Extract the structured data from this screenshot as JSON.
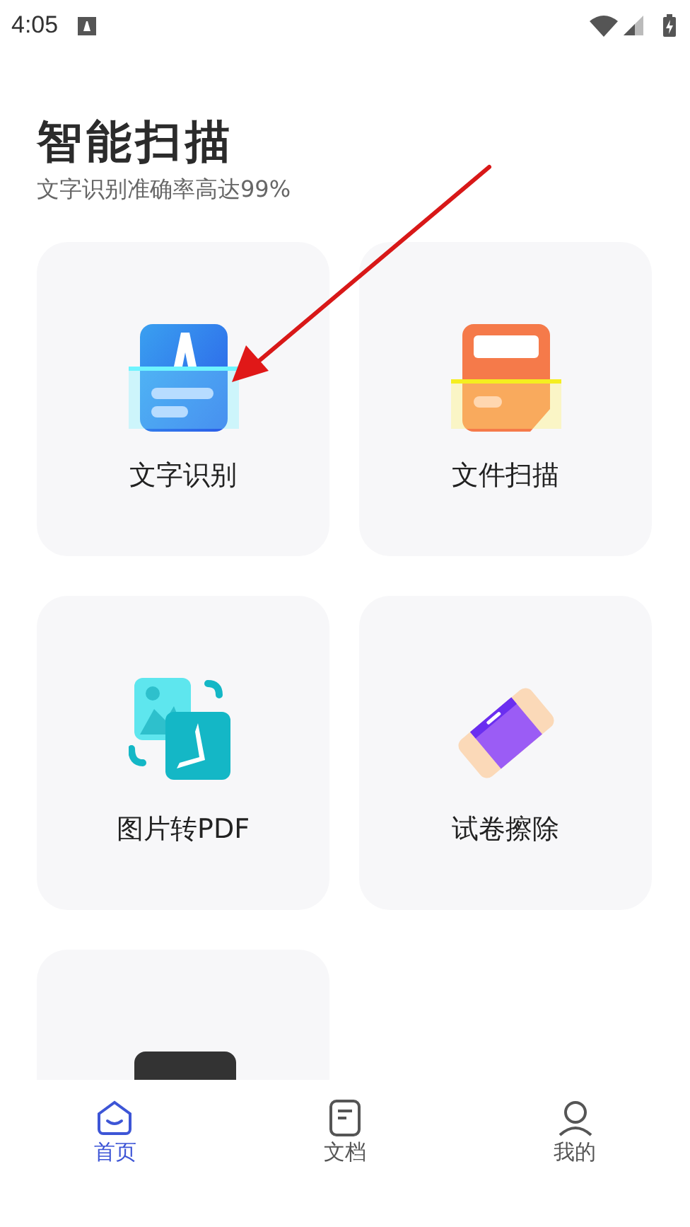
{
  "status_bar": {
    "time": "4:05"
  },
  "header": {
    "title": "智能扫描",
    "subtitle": "文字识别准确率高达99%"
  },
  "cards": [
    {
      "kind": "text-scan",
      "label": "文字识别"
    },
    {
      "kind": "file-scan",
      "label": "文件扫描"
    },
    {
      "kind": "image-pdf",
      "label": "图片转PDF"
    },
    {
      "kind": "erase",
      "label": "试卷擦除"
    },
    {
      "kind": "dark-tool"
    }
  ],
  "nav": [
    {
      "kind": "home",
      "label": "首页",
      "selected": true
    },
    {
      "kind": "doc",
      "label": "文档",
      "selected": false
    },
    {
      "kind": "user",
      "label": "我的",
      "selected": false
    }
  ]
}
